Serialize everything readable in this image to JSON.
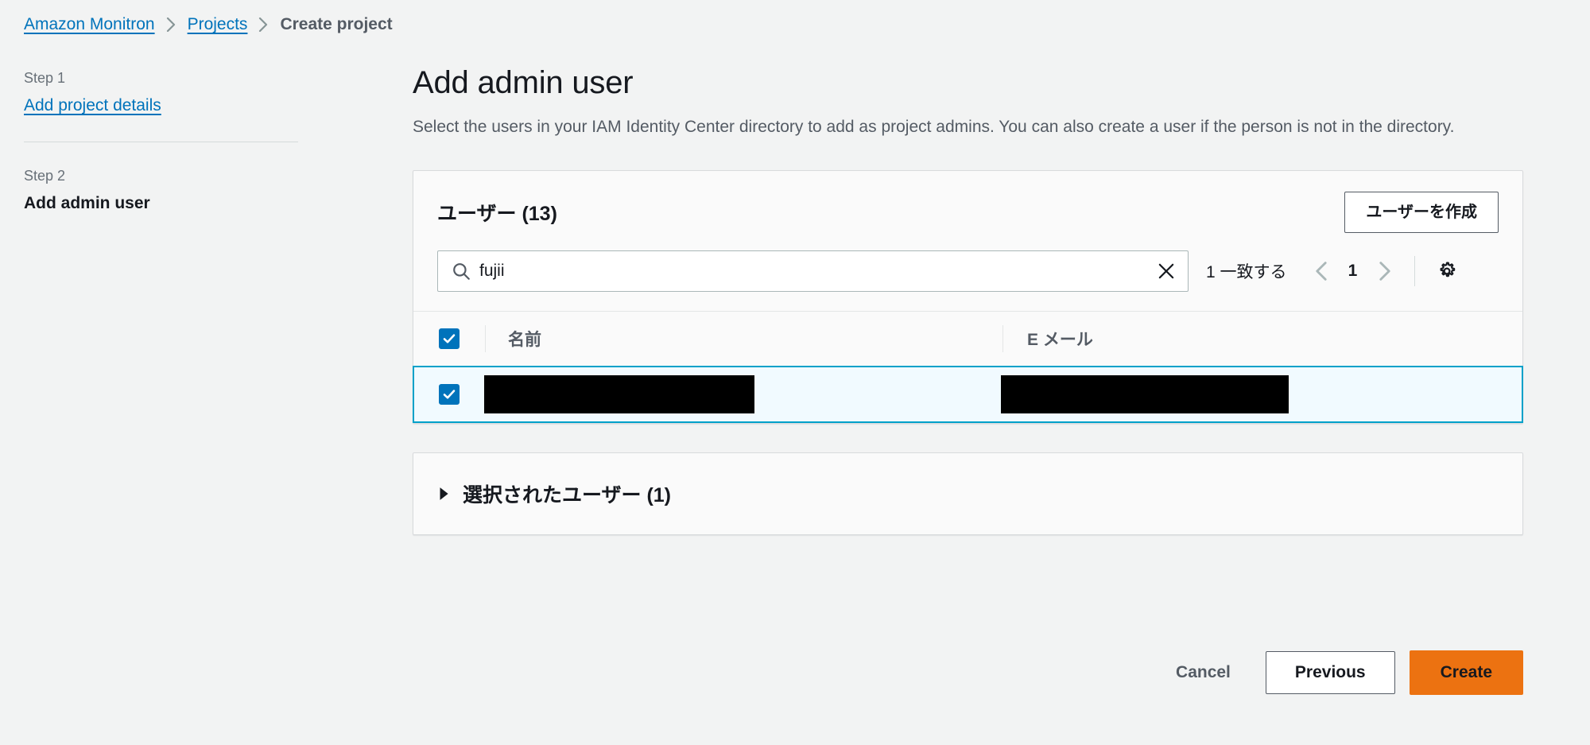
{
  "breadcrumb": {
    "items": [
      {
        "label": "Amazon Monitron",
        "type": "link"
      },
      {
        "label": "Projects",
        "type": "link"
      },
      {
        "label": "Create project",
        "type": "current"
      }
    ]
  },
  "steps": [
    {
      "number_label": "Step 1",
      "title": "Add project details",
      "state": "link"
    },
    {
      "number_label": "Step 2",
      "title": "Add admin user",
      "state": "current"
    }
  ],
  "main": {
    "title": "Add admin user",
    "description": "Select the users in your IAM Identity Center directory to add as project admins. You can also create a user if the person is not in the directory."
  },
  "users_card": {
    "title": "ユーザー (13)",
    "create_user_button": "ユーザーを作成",
    "search": {
      "value": "fujii",
      "placeholder": "",
      "clear_icon": "close-icon",
      "search_icon": "search-icon"
    },
    "match_text": "1 一致する",
    "pagination": {
      "prev_icon": "chevron-left-icon",
      "page": "1",
      "next_icon": "chevron-right-icon"
    },
    "settings_icon": "gear-icon",
    "table": {
      "select_all_checked": true,
      "columns": [
        {
          "label": "名前"
        },
        {
          "label": "E メール"
        }
      ],
      "rows": [
        {
          "checked": true,
          "selected": true,
          "name": "",
          "name_redacted": true,
          "email": "",
          "email_redacted": true
        }
      ]
    }
  },
  "selected_panel": {
    "expanded": false,
    "caret_icon": "caret-right-icon",
    "title": "選択されたユーザー (1)"
  },
  "footer": {
    "cancel_label": "Cancel",
    "previous_label": "Previous",
    "create_label": "Create"
  },
  "colors": {
    "accent_link": "#0073bb",
    "create_button": "#ec7211",
    "selected_row_border": "#00a1c9",
    "selected_row_bg": "#f1faff",
    "page_bg": "#f2f3f3"
  }
}
